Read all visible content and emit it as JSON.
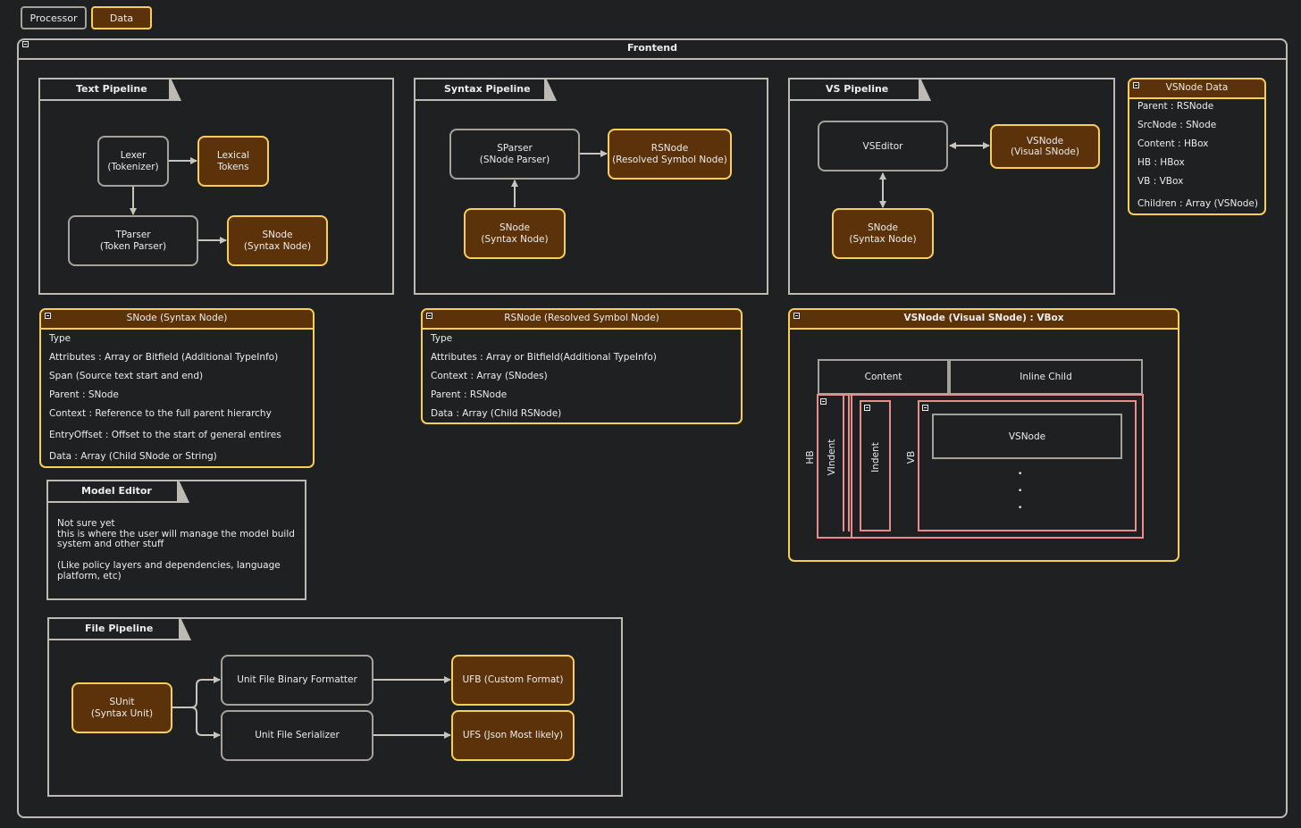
{
  "legend": {
    "processor": "Processor",
    "data": "Data"
  },
  "frontend": {
    "title": "Frontend"
  },
  "text_pipeline": {
    "title": "Text Pipeline",
    "lexer": "Lexer\n(Tokenizer)",
    "lexical_tokens": "Lexical\nTokens",
    "tparser": "TParser\n(Token Parser)",
    "snode": "SNode\n(Syntax Node)"
  },
  "syntax_pipeline": {
    "title": "Syntax Pipeline",
    "sparser": "SParser\n(SNode Parser)",
    "rsnode": "RSNode\n(Resolved Symbol Node)",
    "snode": "SNode\n(Syntax Node)"
  },
  "vs_pipeline": {
    "title": "VS Pipeline",
    "vseditor": "VSEditor",
    "vsnode": "VSNode\n(Visual SNode)",
    "snode": "SNode\n(Syntax Node)"
  },
  "vsnode_data": {
    "title": "VSNode Data",
    "rows": [
      "Parent : RSNode",
      "SrcNode : SNode",
      "Content : HBox",
      "HB : HBox",
      "VB : VBox",
      "Children : Array (VSNode)"
    ]
  },
  "snode_card": {
    "title": "SNode (Syntax Node)",
    "rows": [
      "Type",
      "Attributes : Array or Bitfield (Additional TypeInfo)",
      "Span (Source text start and end)",
      "Parent : SNode",
      "Context : Reference to the full parent hierarchy",
      "EntryOffset : Offset to the start of general entires",
      "Data : Array (Child SNode or String)"
    ]
  },
  "rsnode_card": {
    "title": "RSNode (Resolved Symbol Node)",
    "rows": [
      "Type",
      "Attributes : Array or Bitfield(Additional TypeInfo)",
      "Context : Array (SNodes)",
      "Parent : RSNode",
      "Data : Array (Child RSNode)"
    ]
  },
  "vsnode_vbox": {
    "title": "VSNode (Visual SNode) : VBox",
    "content": "Content",
    "inline_child": "Inline Child",
    "hb": "HB",
    "vindent": "VIndent",
    "indent": "Indent",
    "vb": "VB",
    "vsnode": "VSNode",
    "dots": [
      "•",
      "•",
      "•"
    ]
  },
  "model_editor": {
    "title": "Model Editor",
    "text1": "Not sure yet\nthis is where the user will manage the model build\nsystem and other stuff",
    "text2": "(Like policy layers and dependencies, language\nplatform, etc)"
  },
  "file_pipeline": {
    "title": "File Pipeline",
    "sunit": "SUnit\n(Syntax Unit)",
    "binary_formatter": "Unit File Binary Formatter",
    "serializer": "Unit File Serializer",
    "ufb": "UFB (Custom Format)",
    "ufs": "UFS (Json Most likely)"
  },
  "colors": {
    "data_fill": "#5b3209",
    "data_border": "#f7cf57",
    "processor_border": "#a5a29b",
    "background": "#1e2021",
    "vbox_pink": "#e88c8c"
  }
}
